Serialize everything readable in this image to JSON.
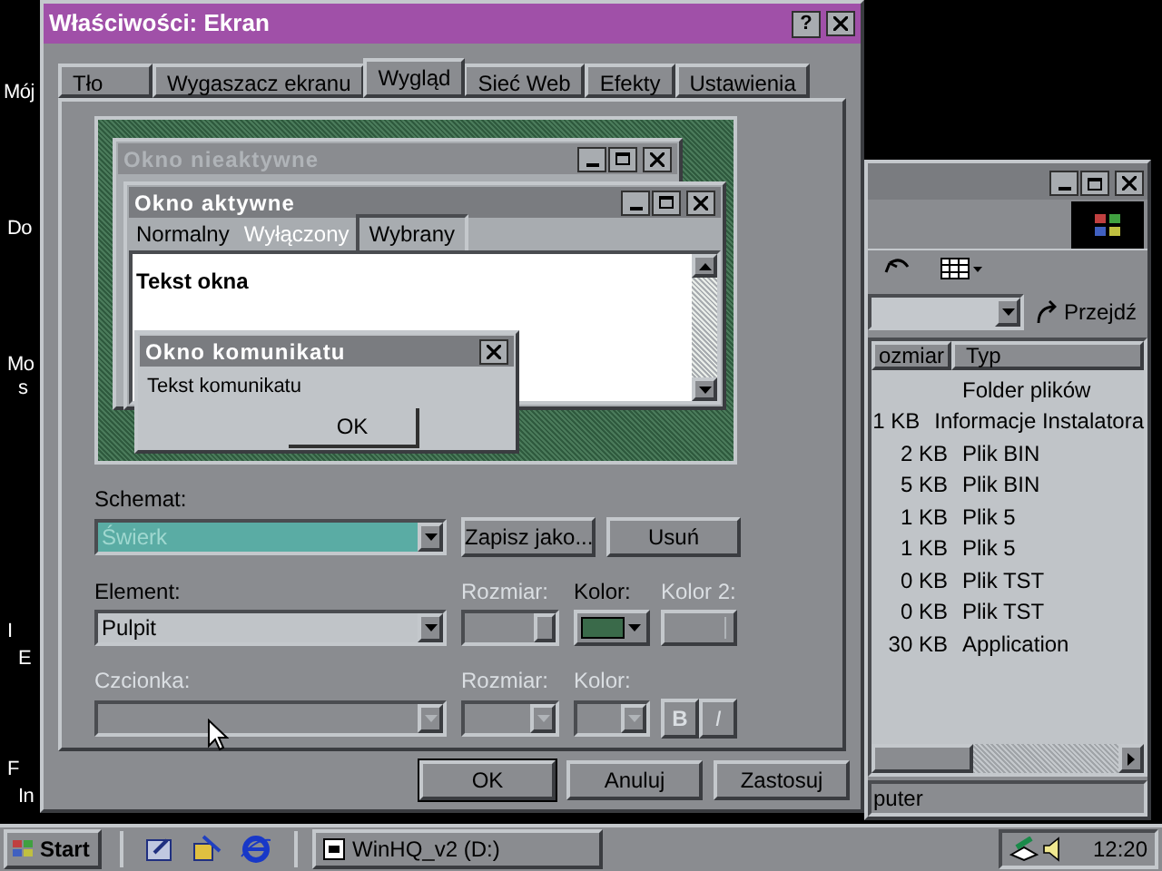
{
  "desktop_labels": [
    "Mój",
    "Do",
    "Mo",
    "s",
    "I",
    "E",
    "F",
    "In"
  ],
  "dialog": {
    "title": "Właściwości: Ekran",
    "help": "?",
    "tabs": [
      {
        "label": "Tło",
        "selected": false
      },
      {
        "label": "Wygaszacz ekranu",
        "selected": false
      },
      {
        "label": "Wygląd",
        "selected": true
      },
      {
        "label": "Sieć Web",
        "selected": false
      },
      {
        "label": "Efekty",
        "selected": false
      },
      {
        "label": "Ustawienia",
        "selected": false
      }
    ],
    "preview": {
      "inactive_title": "Okno nieaktywne",
      "active_title": "Okno aktywne",
      "menu": [
        {
          "label": "Normalny",
          "kind": "normal"
        },
        {
          "label": "Wyłączony",
          "kind": "disabled"
        },
        {
          "label": "Wybrany",
          "kind": "selected"
        }
      ],
      "window_text": "Tekst okna",
      "message_title": "Okno komunikatu",
      "message_text": "Tekst komunikatu",
      "ok": "OK"
    },
    "scheme": {
      "label": "Schemat:",
      "value": "Świerk",
      "save_as": "Zapisz jako...",
      "delete": "Usuń"
    },
    "element": {
      "label": "Element:",
      "value": "Pulpit",
      "size_label": "Rozmiar:",
      "size_disabled": true,
      "color_label": "Kolor:",
      "color": "#3a6a4a",
      "color2_label": "Kolor 2:",
      "color2_disabled": true
    },
    "font": {
      "label": "Czcionka:",
      "size_label": "Rozmiar:",
      "color_label": "Kolor:",
      "bold": "B",
      "italic": "I",
      "disabled": true
    },
    "buttons": [
      {
        "label": "OK",
        "default": true
      },
      {
        "label": "Anuluj",
        "default": false
      },
      {
        "label": "Zastosuj",
        "default": false
      }
    ]
  },
  "explorer": {
    "go": "Przejdź",
    "columns": [
      "ozmiar",
      "Typ"
    ],
    "rows": [
      {
        "size": "",
        "type": "Folder plików"
      },
      {
        "size": "1 KB",
        "type": "Informacje Instalatora"
      },
      {
        "size": "2 KB",
        "type": "Plik BIN"
      },
      {
        "size": "5 KB",
        "type": "Plik BIN"
      },
      {
        "size": "1 KB",
        "type": "Plik 5"
      },
      {
        "size": "1 KB",
        "type": "Plik 5"
      },
      {
        "size": "0 KB",
        "type": "Plik TST"
      },
      {
        "size": "0 KB",
        "type": "Plik TST"
      },
      {
        "size": "30 KB",
        "type": "Application"
      }
    ],
    "status": "puter"
  },
  "taskbar": {
    "start": "Start",
    "task": "WinHQ_v2 (D:)",
    "clock": "12:20"
  }
}
